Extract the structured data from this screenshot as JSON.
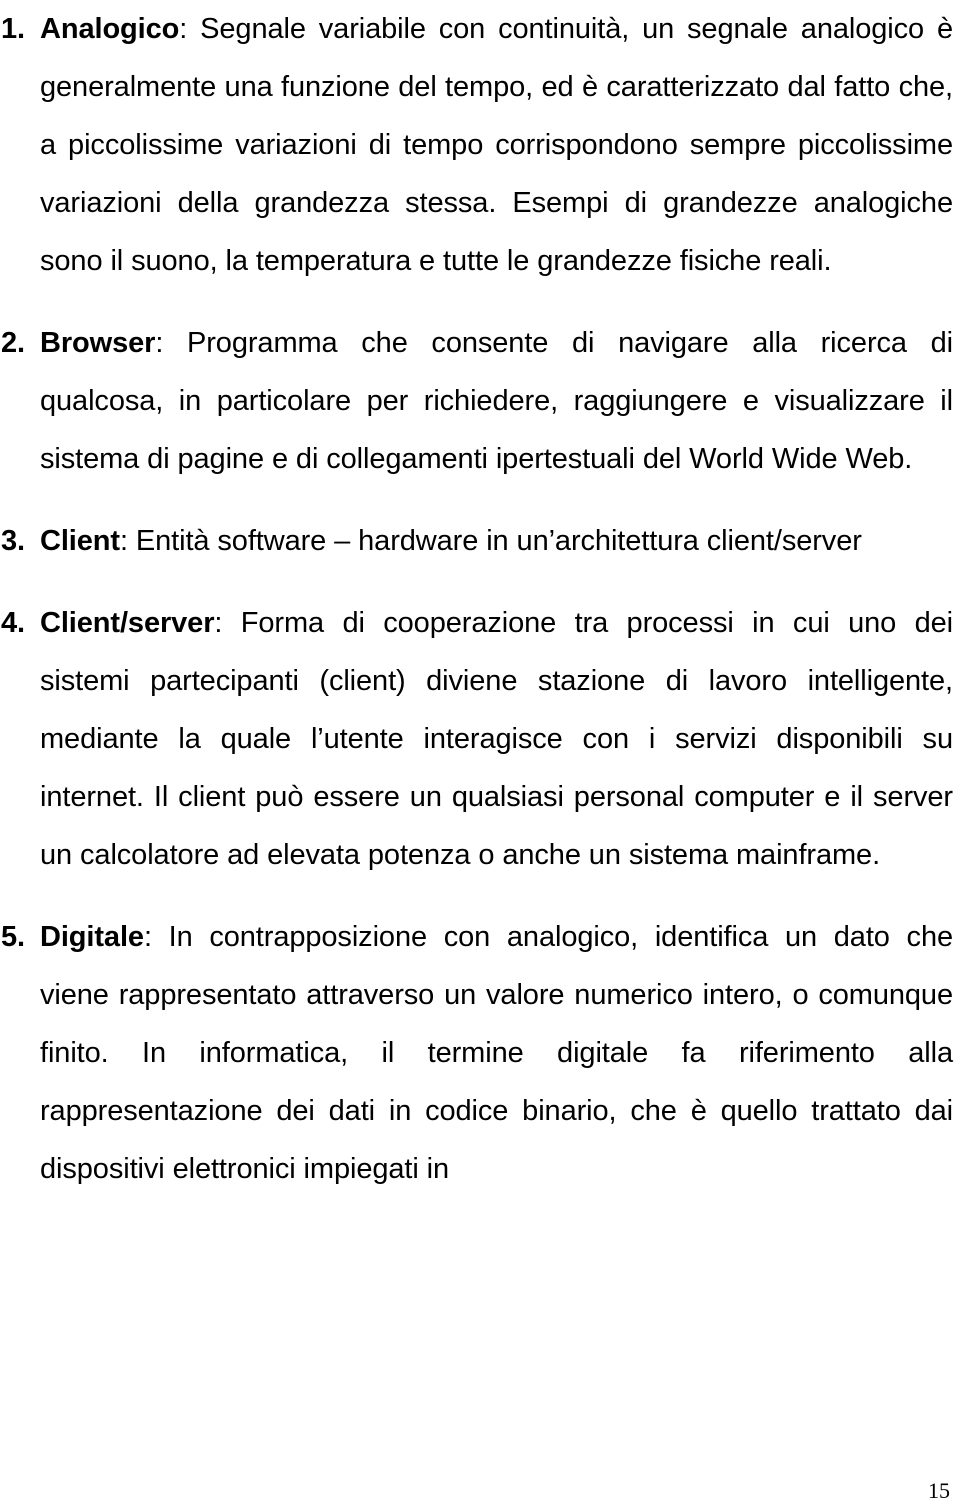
{
  "document": {
    "entries": [
      {
        "number": "1.",
        "term": "Analogico",
        "separator": ":",
        "definition": " Segnale variabile con continuità, un segnale analogico è generalmente una funzione del tempo, ed è caratterizzato dal fatto che, a piccolissime variazioni di tempo corrispondono sempre piccolissime variazioni della grandezza stessa. Esempi di grandezze analogiche sono il suono, la temperatura e tutte le grandezze fisiche reali."
      },
      {
        "number": "2.",
        "term": "Browser",
        "separator": ":",
        "definition": " Programma che consente di navigare alla ricerca di qualcosa, in particolare per richiedere, raggiungere e visualizzare il sistema di pagine e di collegamenti ipertestuali del World Wide Web."
      },
      {
        "number": "3.",
        "term": "Client",
        "separator": ":",
        "definition": " Entità software – hardware in un’architettura client/server"
      },
      {
        "number": "4.",
        "term": "Client/server",
        "separator": ":",
        "definition": " Forma di cooperazione tra processi in cui uno dei sistemi partecipanti (client) diviene stazione di lavoro intelligente, mediante la quale l’utente interagisce con i servizi disponibili su internet. Il client può essere un qualsiasi personal computer e il server un calcolatore ad elevata potenza o anche un sistema mainframe."
      },
      {
        "number": "5.",
        "term": "Digitale",
        "separator": ":",
        "definition": " In contrapposizione con analogico, identifica un dato che viene rappresentato attraverso un valore numerico intero, o comunque finito. In informatica, il termine digitale fa riferimento alla rappresentazione dei dati in codice binario, che è quello trattato dai dispositivi elettronici impiegati in"
      }
    ],
    "page_number": "15"
  }
}
